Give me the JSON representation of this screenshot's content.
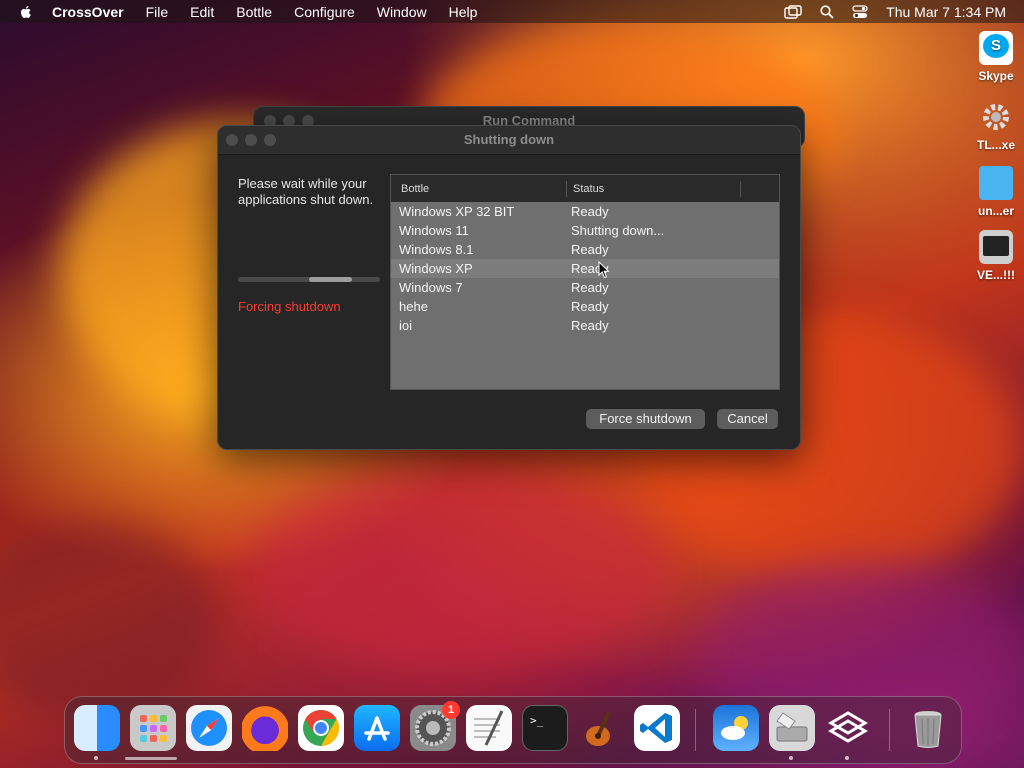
{
  "menubar": {
    "app_name": "CrossOver",
    "items": [
      "File",
      "Edit",
      "Bottle",
      "Configure",
      "Window",
      "Help"
    ],
    "clock": "Thu Mar 7  1:34 PM"
  },
  "desktop_icons": [
    {
      "label": "Skype"
    },
    {
      "label": "TL...xe"
    },
    {
      "label": "un...er"
    },
    {
      "label": "VE...!!!"
    }
  ],
  "back_window": {
    "title": "Run Command"
  },
  "dialog": {
    "title": "Shutting down",
    "wait_text": "Please wait while your applications shut down.",
    "progress_fraction_start": 0.5,
    "progress_fraction_end": 0.8,
    "forcing_text": "Forcing shutdown",
    "columns": [
      "Bottle",
      "Status"
    ],
    "rows": [
      {
        "bottle": "Windows XP 32 BIT",
        "status": "Ready"
      },
      {
        "bottle": "Windows 11",
        "status": "Shutting down..."
      },
      {
        "bottle": "Windows 8.1",
        "status": "Ready"
      },
      {
        "bottle": "Windows XP",
        "status": "Ready"
      },
      {
        "bottle": "Windows 7",
        "status": "Ready"
      },
      {
        "bottle": "hehe",
        "status": "Ready"
      },
      {
        "bottle": "ioi",
        "status": "Ready"
      }
    ],
    "force_button": "Force shutdown",
    "cancel_button": "Cancel"
  },
  "dock": {
    "settings_badge": "1",
    "items": [
      "finder-icon",
      "launchpad-icon",
      "safari-icon",
      "firefox-icon",
      "chrome-icon",
      "app-store-icon",
      "system-settings-icon",
      "textedit-icon",
      "terminal-icon",
      "garageband-icon",
      "vscode-icon",
      "weather-icon",
      "crossover-disk-icon",
      "crossover-app-icon",
      "trash-icon"
    ]
  },
  "colors": {
    "forcing_red": "#ff3b30",
    "dialog_bg": "#262626",
    "table_bg": "#6f6f6f"
  }
}
